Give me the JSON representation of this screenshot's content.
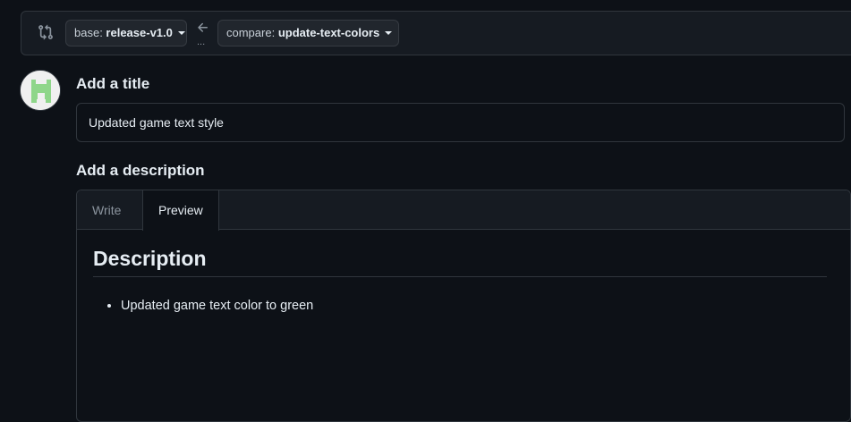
{
  "range": {
    "base_prefix": "base: ",
    "base_branch": "release-v1.0",
    "compare_prefix": "compare: ",
    "compare_branch": "update-text-colors",
    "separator_dots": "..."
  },
  "title_section": {
    "label": "Add a title",
    "input_value": "Updated game text style"
  },
  "description_section": {
    "label": "Add a description",
    "tabs": [
      {
        "label": "Write",
        "active": false
      },
      {
        "label": "Preview",
        "active": true
      }
    ],
    "preview": {
      "heading": "Description",
      "bullets": [
        "Updated game text color to green"
      ]
    }
  },
  "icons": {
    "compare": "git-compare-icon",
    "arrow": "arrow-left-icon",
    "caret": "triangle-down-icon",
    "avatar": "identicon-avatar"
  },
  "colors": {
    "background": "#0d1117",
    "surface": "#161b22",
    "border": "#30363d",
    "text": "#e6edf3",
    "muted": "#8b949e",
    "avatar_green": "#8fd68a"
  }
}
